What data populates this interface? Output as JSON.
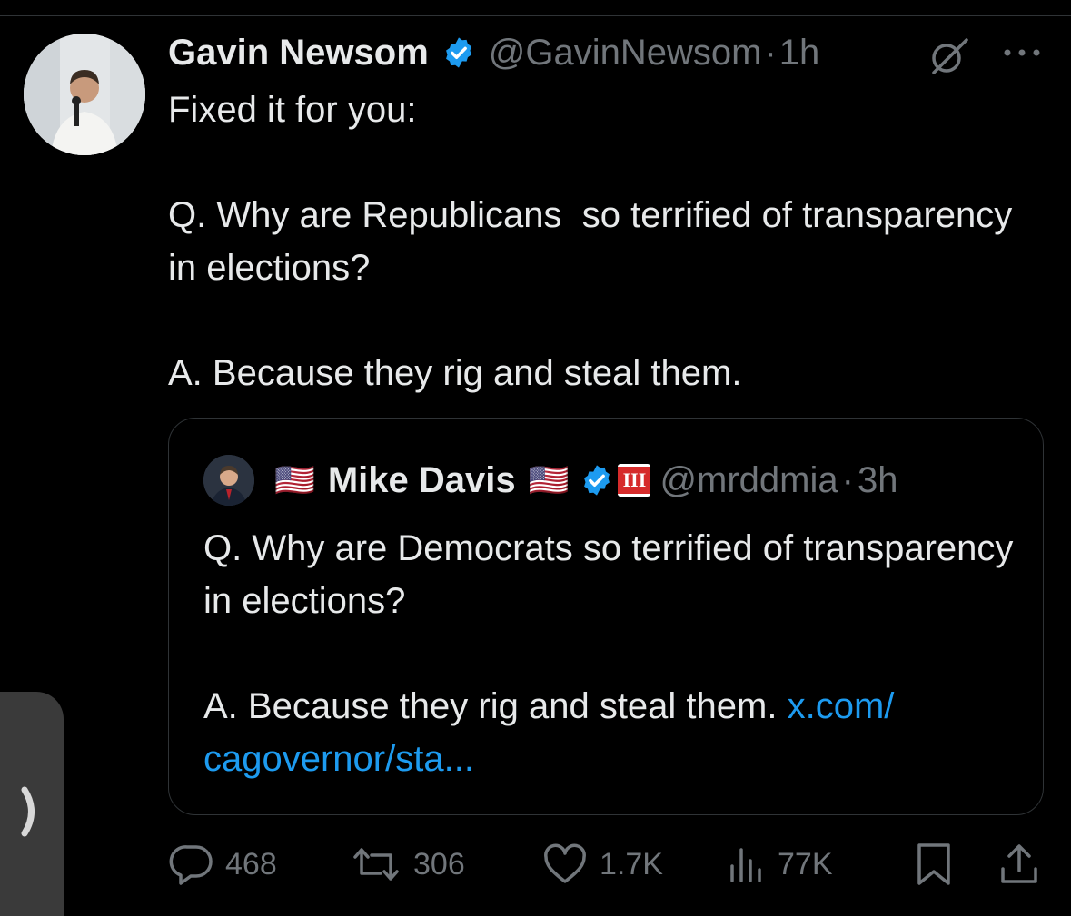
{
  "tweet": {
    "author_name": "Gavin Newsom",
    "handle": "@GavinNewsom",
    "separator": "·",
    "time": "1h",
    "body": "Fixed it for you:\n\nQ. Why are Republicans  so terrified of transparency in elections?\n\nA. Because they rig and steal them."
  },
  "quoted": {
    "flag_left": "🇺🇸",
    "author_name": "Mike Davis",
    "flag_right": "🇺🇸",
    "roman_badge": "III",
    "handle": "@mrddmia",
    "separator": "·",
    "time": "3h",
    "body": "Q. Why are Democrats so terrified of transparency in elections?\n\nA. Because they rig and steal them. ",
    "link": "x.com/\ncagovernor/sta..."
  },
  "actions": {
    "replies": "468",
    "reposts": "306",
    "likes": "1.7K",
    "views": "77K"
  },
  "icons": [
    "verified-badge-icon",
    "grok-icon",
    "more-icon",
    "reply-icon",
    "repost-icon",
    "like-icon",
    "views-icon",
    "bookmark-icon",
    "share-icon",
    "chevron-right-icon"
  ],
  "colors": {
    "background": "#000000",
    "text": "#e7e9ea",
    "muted": "#71767b",
    "link": "#1d9bf0",
    "verified": "#1d9bf0",
    "border": "#2f3336"
  }
}
